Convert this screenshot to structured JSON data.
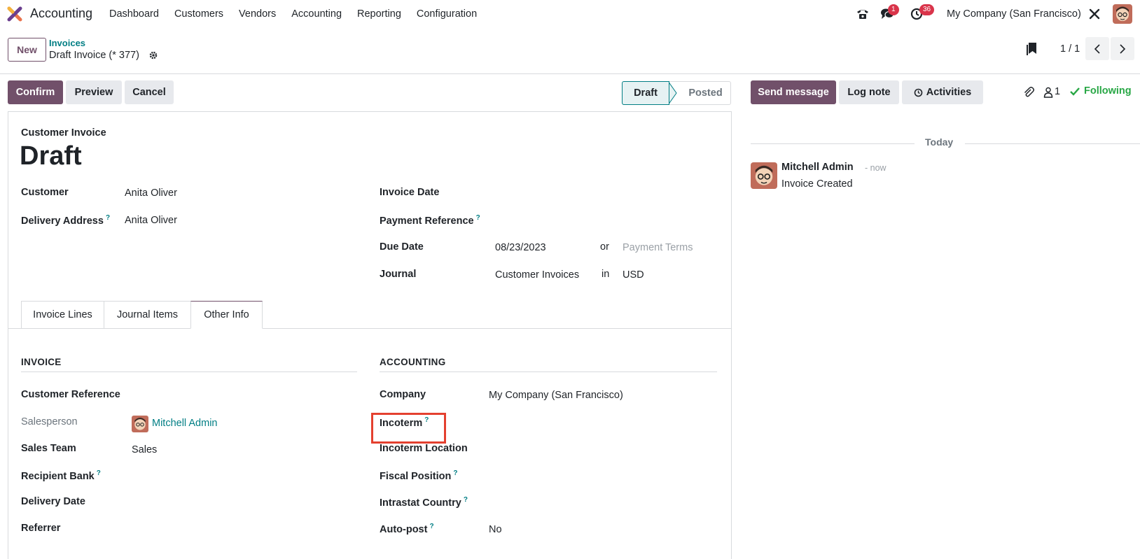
{
  "app": {
    "name": "Accounting"
  },
  "menu": [
    "Dashboard",
    "Customers",
    "Vendors",
    "Accounting",
    "Reporting",
    "Configuration"
  ],
  "systray": {
    "messages_count": "1",
    "activities_count": "36",
    "company": "My Company (San Francisco)"
  },
  "control_panel": {
    "new_label": "New",
    "breadcrumb_parent": "Invoices",
    "breadcrumb_current": "Draft Invoice (* 377)",
    "pager": "1 / 1"
  },
  "actions": {
    "confirm": "Confirm",
    "preview": "Preview",
    "cancel": "Cancel"
  },
  "statusbar": {
    "draft": "Draft",
    "posted": "Posted"
  },
  "form": {
    "subtitle": "Customer Invoice",
    "title": "Draft",
    "customer_label": "Customer",
    "customer_value": "Anita Oliver",
    "delivery_address_label": "Delivery Address",
    "delivery_address_value": "Anita Oliver",
    "invoice_date_label": "Invoice Date",
    "payment_reference_label": "Payment Reference",
    "due_date_label": "Due Date",
    "due_date_value": "08/23/2023",
    "or_text": "or",
    "payment_terms_placeholder": "Payment Terms",
    "journal_label": "Journal",
    "journal_value": "Customer Invoices",
    "in_text": "in",
    "currency_value": "USD",
    "help_mark": "?"
  },
  "tabs": [
    {
      "label": "Invoice Lines"
    },
    {
      "label": "Journal Items"
    },
    {
      "label": "Other Info"
    }
  ],
  "other_info": {
    "invoice_section": "INVOICE",
    "accounting_section": "ACCOUNTING",
    "customer_reference_label": "Customer Reference",
    "salesperson_label": "Salesperson",
    "salesperson_value": "Mitchell Admin",
    "sales_team_label": "Sales Team",
    "sales_team_value": "Sales",
    "recipient_bank_label": "Recipient Bank",
    "delivery_date_label": "Delivery Date",
    "referrer_label": "Referrer",
    "company_label": "Company",
    "company_value": "My Company (San Francisco)",
    "incoterm_label": "Incoterm",
    "incoterm_location_label": "Incoterm Location",
    "fiscal_position_label": "Fiscal Position",
    "intrastat_country_label": "Intrastat Country",
    "auto_post_label": "Auto-post",
    "auto_post_value": "No"
  },
  "chatter": {
    "send_message": "Send message",
    "log_note": "Log note",
    "activities": "Activities",
    "followers_count": "1",
    "following": "Following",
    "today": "Today",
    "author": "Mitchell Admin",
    "time": "- now",
    "body": "Invoice Created"
  },
  "colors": {
    "primary": "#71506a",
    "link": "#017e84",
    "badge": "#d9344a",
    "highlight": "#e4402f",
    "following": "#28a745"
  }
}
